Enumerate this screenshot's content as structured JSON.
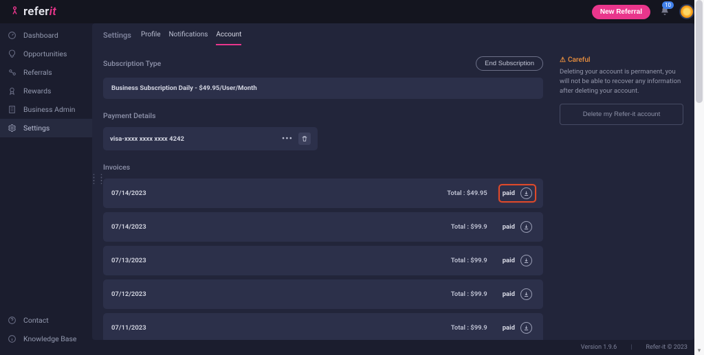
{
  "header": {
    "brand_pre": "refer",
    "brand_accent": "it",
    "new_referral_label": "New Referral",
    "notif_count": "10"
  },
  "sidebar": {
    "top": [
      {
        "label": "Dashboard",
        "icon": "gauge-icon"
      },
      {
        "label": "Opportunities",
        "icon": "lightbulb-icon"
      },
      {
        "label": "Referrals",
        "icon": "people-arrow-icon"
      },
      {
        "label": "Rewards",
        "icon": "badge-icon"
      },
      {
        "label": "Business Admin",
        "icon": "building-icon"
      },
      {
        "label": "Settings",
        "icon": "gear-icon"
      }
    ],
    "bottom": [
      {
        "label": "Contact",
        "icon": "help-icon"
      },
      {
        "label": "Knowledge Base",
        "icon": "info-icon"
      }
    ]
  },
  "tabs": {
    "page_title": "Settings",
    "items": [
      {
        "label": "Profile"
      },
      {
        "label": "Notifications"
      },
      {
        "label": "Account"
      }
    ]
  },
  "subscription": {
    "section_label": "Subscription Type",
    "end_label": "End Subscription",
    "plan_text": "Business Subscription Daily - $49.95/User/Month"
  },
  "payment": {
    "section_label": "Payment Details",
    "card_text": "visa-xxxx xxxx xxxx 4242"
  },
  "invoices": {
    "section_label": "Invoices",
    "total_label_prefix": "Total : ",
    "rows": [
      {
        "date": "07/14/2023",
        "total": "$49.95",
        "status": "paid",
        "highlight": true
      },
      {
        "date": "07/14/2023",
        "total": "$99.9",
        "status": "paid",
        "highlight": false
      },
      {
        "date": "07/13/2023",
        "total": "$99.9",
        "status": "paid",
        "highlight": false
      },
      {
        "date": "07/12/2023",
        "total": "$99.9",
        "status": "paid",
        "highlight": false
      },
      {
        "date": "07/11/2023",
        "total": "$99.9",
        "status": "paid",
        "highlight": false
      }
    ]
  },
  "danger": {
    "title": "Careful",
    "body": "Deleting your account is permanent, you will not be able to recover any information after deleting your account.",
    "delete_label": "Delete my Refer-it account"
  },
  "footer": {
    "version": "Version 1.9.6",
    "copyright": "Refer-it © 2023"
  }
}
